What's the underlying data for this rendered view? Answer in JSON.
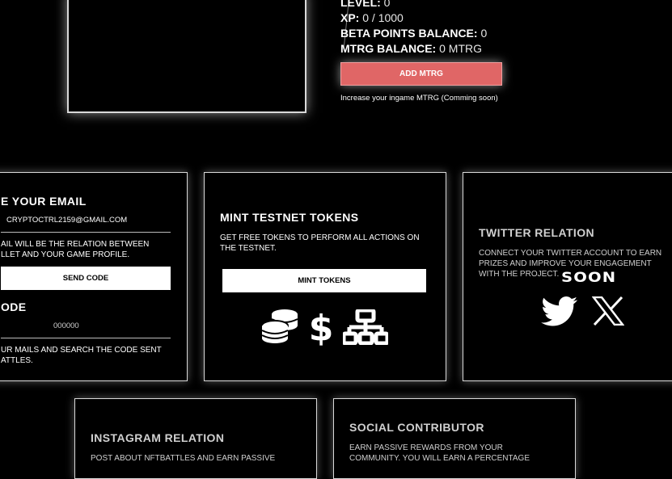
{
  "profile": {
    "level_label": "LEVEL:",
    "level_value": "0",
    "xp_label": "XP:",
    "xp_value": "0 / 1000",
    "beta_label": "BETA POINTS BALANCE:",
    "beta_value": "0",
    "mtrg_label": "MTRG BALANCE:",
    "mtrg_value": "0 MTRG",
    "add_button": "ADD MTRG",
    "add_hint": "Increase your ingame MTRG (Comming soon)"
  },
  "email_card": {
    "title": "E YOUR EMAIL",
    "email_value": "CRYPTOCTRL2159@GMAIL.COM",
    "desc_line1": "AIL WILL BE THE RELATION BETWEEN",
    "desc_line2": "LLET AND YOUR GAME PROFILE.",
    "send_button": "SEND CODE",
    "code_title": "ODE",
    "code_placeholder": "000000",
    "hint_line1": "UR MAILS AND SEARCH THE CODE SENT",
    "hint_line2": "ATTLES."
  },
  "mint_card": {
    "title": "MINT TESTNET TOKENS",
    "desc": "GET FREE TOKENS TO PERFORM ALL ACTIONS ON THE TESTNET.",
    "button": "MINT TOKENS",
    "icons": [
      "coins-icon",
      "dollar-icon",
      "network-icon"
    ]
  },
  "twitter_card": {
    "title": "TWITTER RELATION",
    "desc": "CONNECT YOUR TWITTER ACCOUNT TO EARN PRIZES AND IMPROVE YOUR ENGAGEMENT WITH THE PROJECT.",
    "badge": "SOON",
    "icons": [
      "twitter-bird-icon",
      "x-logo-icon"
    ]
  },
  "instagram_card": {
    "title": "INSTAGRAM RELATION",
    "desc": "POST ABOUT NFTBATTLES AND EARN PASSIVE"
  },
  "social_card": {
    "title": "SOCIAL CONTRIBUTOR",
    "desc_line1": "EARN PASSIVE REWARDS FROM YOUR",
    "desc_line2": "COMMUNITY. YOU WILL EARN A PERCENTAGE"
  },
  "colors": {
    "accent": "#e06666",
    "border": "#d9d9d9",
    "background": "#000000"
  }
}
